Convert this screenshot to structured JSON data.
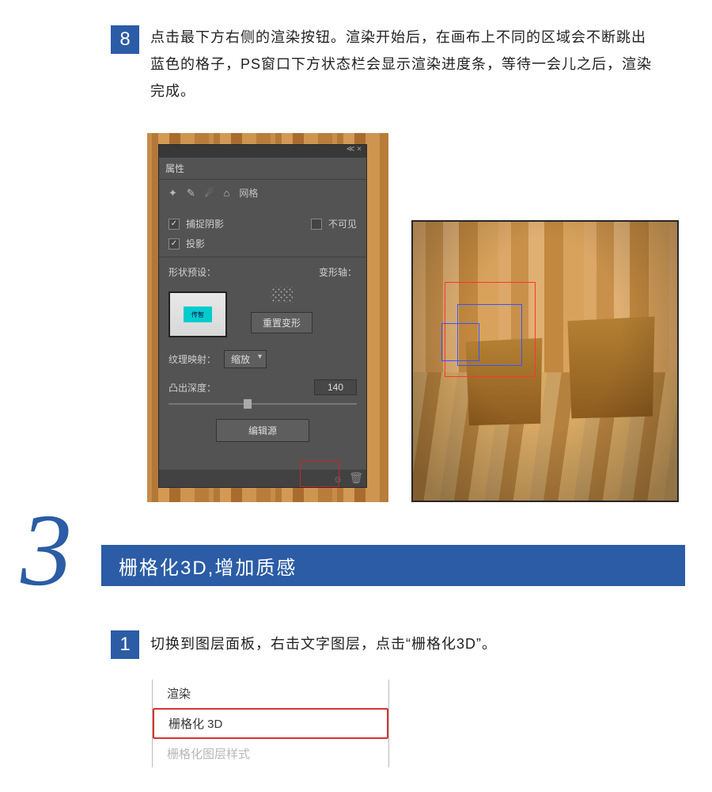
{
  "step8": {
    "num": "8",
    "text": "点击最下方右侧的渲染按钮。渲染开始后，在画布上不同的区域会不断跳出蓝色的格子，PS窗口下方状态栏会显示渲染进度条，等待一会儿之后，渲染完成。"
  },
  "panel": {
    "tab": "属性",
    "meshLabel": "网格",
    "catchShadow": "捕捉阴影",
    "invisible": "不可见",
    "castShadow": "投影",
    "shapePreset": "形状预设：",
    "deformAxis": "变形轴：",
    "resetDeform": "重置变形",
    "textureMap": "纹理映射：",
    "textureValue": "缩放",
    "extrudeDepth": "凸出深度：",
    "depthValue": "140",
    "editSource": "编辑源",
    "swatchText": "传智"
  },
  "section3": {
    "num": "3",
    "title": "栅格化3D,增加质感"
  },
  "step1": {
    "num": "1",
    "text": "切换到图层面板，右击文字图层，点击“栅格化3D”。"
  },
  "menu": {
    "render": "渲染",
    "raster3d": "栅格化 3D",
    "rasterStyle": "栅格化图层样式"
  }
}
